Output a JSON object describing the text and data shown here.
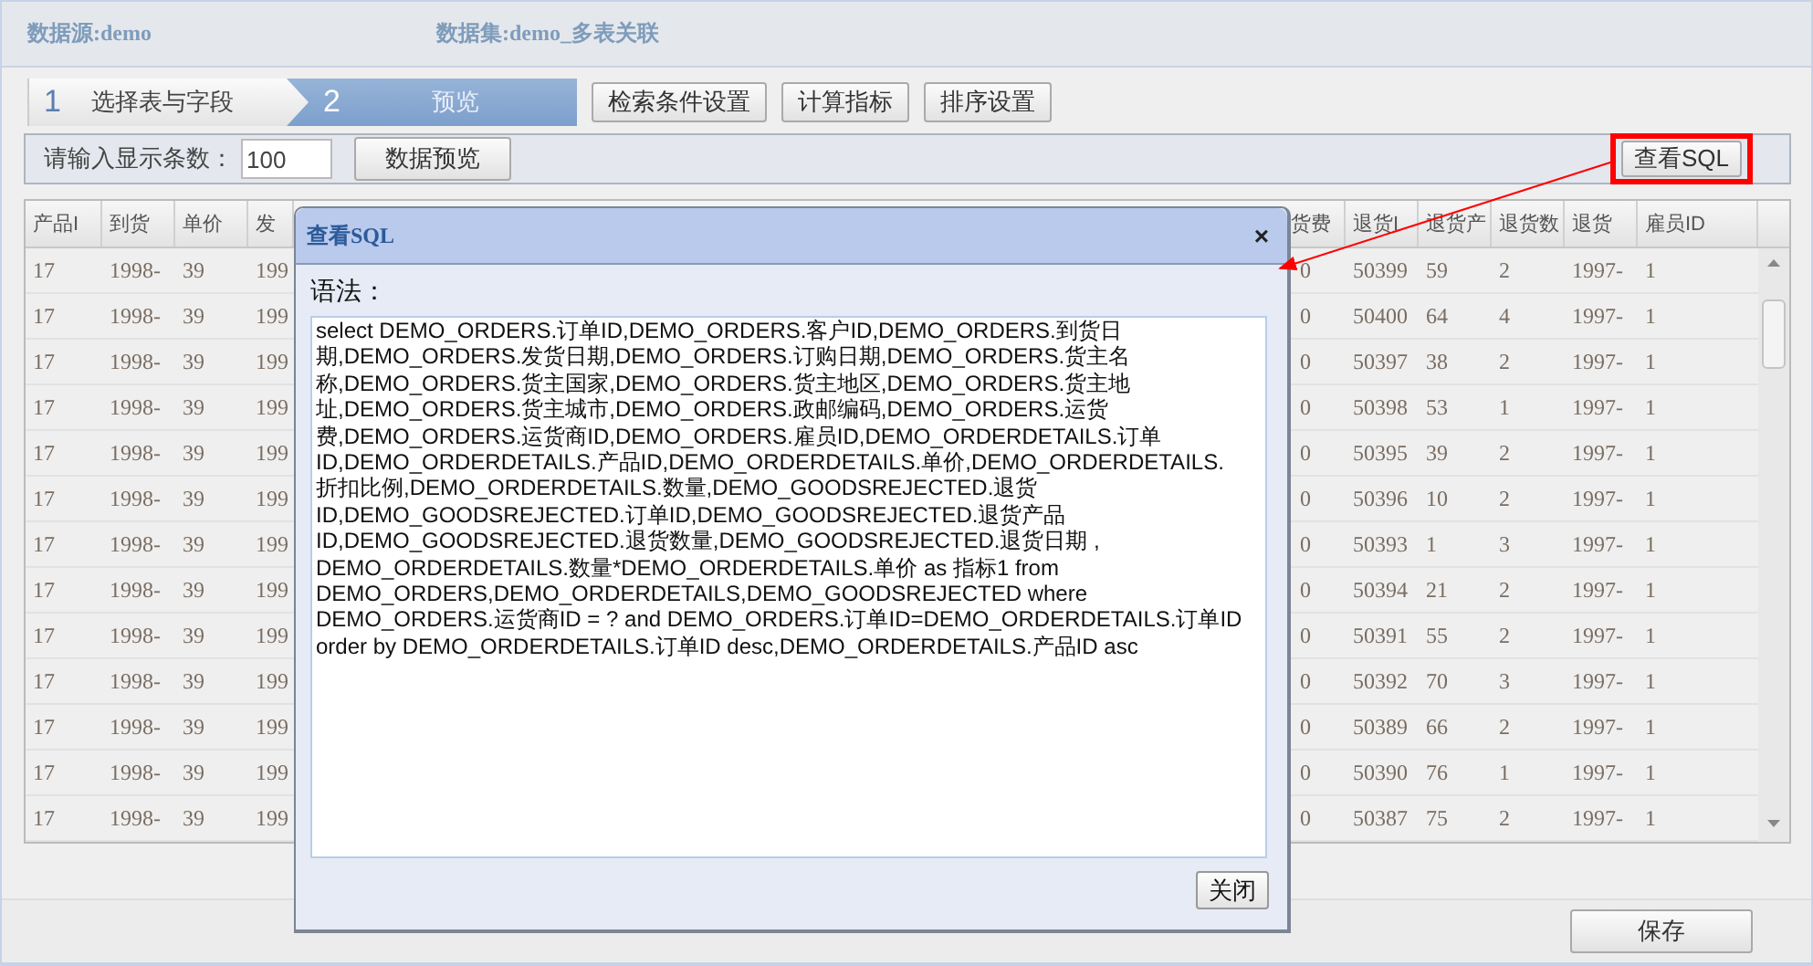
{
  "header": {
    "source": "数据源:demo",
    "dataset": "数据集:demo_多表关联"
  },
  "steps": [
    {
      "number": "1",
      "label": "选择表与字段",
      "selected": false
    },
    {
      "number": "2",
      "label": "预览",
      "selected": true
    }
  ],
  "config_buttons": [
    "检索条件设置",
    "计算指标",
    "排序设置"
  ],
  "toolbar": {
    "count_label": "请输入显示条数：",
    "count_value": "100",
    "preview_button": "数据预览",
    "sql_button": "查看SQL",
    "sql_button_highlighted": true
  },
  "grid": {
    "columns": [
      "产品I",
      "到货",
      "单价",
      "发",
      "货费",
      "退货I",
      "退货产",
      "退货数",
      "退货",
      "雇员ID"
    ],
    "rows": [
      [
        "17",
        "1998-",
        "39",
        "199",
        "0",
        "50399",
        "59",
        "2",
        "1997-",
        "1"
      ],
      [
        "17",
        "1998-",
        "39",
        "199",
        "0",
        "50400",
        "64",
        "4",
        "1997-",
        "1"
      ],
      [
        "17",
        "1998-",
        "39",
        "199",
        "0",
        "50397",
        "38",
        "2",
        "1997-",
        "1"
      ],
      [
        "17",
        "1998-",
        "39",
        "199",
        "0",
        "50398",
        "53",
        "1",
        "1997-",
        "1"
      ],
      [
        "17",
        "1998-",
        "39",
        "199",
        "0",
        "50395",
        "39",
        "2",
        "1997-",
        "1"
      ],
      [
        "17",
        "1998-",
        "39",
        "199",
        "0",
        "50396",
        "10",
        "2",
        "1997-",
        "1"
      ],
      [
        "17",
        "1998-",
        "39",
        "199",
        "0",
        "50393",
        "1",
        "3",
        "1997-",
        "1"
      ],
      [
        "17",
        "1998-",
        "39",
        "199",
        "0",
        "50394",
        "21",
        "2",
        "1997-",
        "1"
      ],
      [
        "17",
        "1998-",
        "39",
        "199",
        "0",
        "50391",
        "55",
        "2",
        "1997-",
        "1"
      ],
      [
        "17",
        "1998-",
        "39",
        "199",
        "0",
        "50392",
        "70",
        "3",
        "1997-",
        "1"
      ],
      [
        "17",
        "1998-",
        "39",
        "199",
        "0",
        "50389",
        "66",
        "2",
        "1997-",
        "1"
      ],
      [
        "17",
        "1998-",
        "39",
        "199",
        "0",
        "50390",
        "76",
        "1",
        "1997-",
        "1"
      ],
      [
        "17",
        "1998-",
        "39",
        "199",
        "0",
        "50387",
        "75",
        "2",
        "1997-",
        "1"
      ]
    ]
  },
  "save_button": "保存",
  "dialog": {
    "title": "查看SQL",
    "close_symbol": "×",
    "syntax_label": "语法：",
    "sql": "select DEMO_ORDERS.订单ID,DEMO_ORDERS.客户ID,DEMO_ORDERS.到货日期,DEMO_ORDERS.发货日期,DEMO_ORDERS.订购日期,DEMO_ORDERS.货主名称,DEMO_ORDERS.货主国家,DEMO_ORDERS.货主地区,DEMO_ORDERS.货主地址,DEMO_ORDERS.货主城市,DEMO_ORDERS.政邮编码,DEMO_ORDERS.运货费,DEMO_ORDERS.运货商ID,DEMO_ORDERS.雇员ID,DEMO_ORDERDETAILS.订单ID,DEMO_ORDERDETAILS.产品ID,DEMO_ORDERDETAILS.单价,DEMO_ORDERDETAILS.折扣比例,DEMO_ORDERDETAILS.数量,DEMO_GOODSREJECTED.退货ID,DEMO_GOODSREJECTED.订单ID,DEMO_GOODSREJECTED.退货产品ID,DEMO_GOODSREJECTED.退货数量,DEMO_GOODSREJECTED.退货日期 , DEMO_ORDERDETAILS.数量*DEMO_ORDERDETAILS.单价 as 指标1  from DEMO_ORDERS,DEMO_ORDERDETAILS,DEMO_GOODSREJECTED  where DEMO_ORDERS.运货商ID = ?  and DEMO_ORDERS.订单ID=DEMO_ORDERDETAILS.订单ID order by DEMO_ORDERDETAILS.订单ID  desc,DEMO_ORDERDETAILS.产品ID  asc",
    "close_button": "关闭"
  }
}
